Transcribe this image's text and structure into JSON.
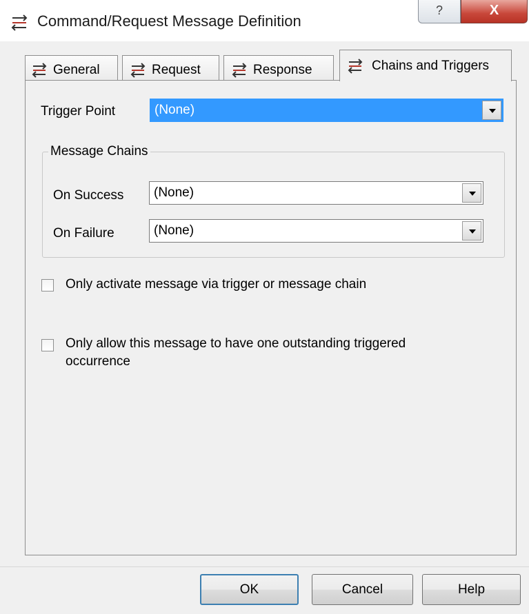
{
  "window": {
    "title": "Command/Request Message Definition",
    "help_glyph": "?",
    "close_glyph": "X"
  },
  "tabs": [
    {
      "label": "General"
    },
    {
      "label": "Request"
    },
    {
      "label": "Response"
    },
    {
      "label": "Chains and Triggers",
      "active": true
    }
  ],
  "trigger": {
    "label": "Trigger Point",
    "value": "(None)"
  },
  "chains": {
    "group_label": "Message Chains",
    "on_success_label": "On Success",
    "on_success_value": "(None)",
    "on_failure_label": "On Failure",
    "on_failure_value": "(None)"
  },
  "options": {
    "only_activate_label": "Only activate message via trigger or message chain",
    "only_activate_checked": false,
    "one_outstanding_label": "Only allow this message to have one outstanding triggered occurrence",
    "one_outstanding_checked": false
  },
  "buttons": {
    "ok": "OK",
    "cancel": "Cancel",
    "help": "Help"
  },
  "colors": {
    "selection": "#3399ff",
    "close_button": "#c8473a",
    "icon_red": "#b5352a",
    "icon_dark": "#333333"
  },
  "icons": {
    "app": "message-arrows-icon",
    "tab": "message-arrows-icon",
    "dropdown": "chevron-down-icon"
  }
}
